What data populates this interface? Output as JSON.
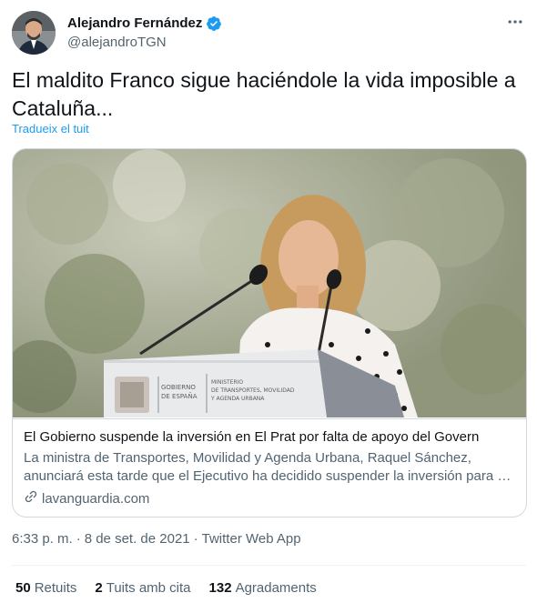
{
  "author": {
    "display_name": "Alejandro Fernández",
    "handle": "@alejandroTGN",
    "verified": true,
    "verified_color": "#1d9bf0"
  },
  "icons": {
    "more": "more-horizontal-icon",
    "verified": "verified-badge-icon",
    "link": "link-icon"
  },
  "tweet": {
    "text": "El maldito Franco sigue haciéndole la vida imposible a Cataluña...",
    "translate_label": "Tradueix el tuit"
  },
  "card": {
    "image_caption_left": "GOBIERNO DE ESPAÑA",
    "image_caption_right": "MINISTERIO DE TRANSPORTES, MOVILIDAD Y AGENDA URBANA",
    "title": "El Gobierno suspende la inversión en El Prat  por falta de apoyo del Govern",
    "description": "La ministra de Transportes, Movilidad y Agenda Urbana, Raquel Sánchez, anunciará esta tarde que el Ejecutivo ha decidido suspender la inversión para el aeropuerto de El Prat...",
    "domain": "lavanguardia.com"
  },
  "meta": {
    "time": "6:33 p. m.",
    "sep1": "·",
    "date": "8 de set. de 2021",
    "sep2": "·",
    "source": "Twitter Web App"
  },
  "stats": {
    "retweets_count": "50",
    "retweets_label": "Retuits",
    "quotes_count": "2",
    "quotes_label": "Tuits amb cita",
    "likes_count": "132",
    "likes_label": "Agradaments"
  },
  "colors": {
    "accent": "#1d9bf0",
    "text": "#0f1419",
    "secondary": "#536471",
    "border": "#cfd9de"
  }
}
